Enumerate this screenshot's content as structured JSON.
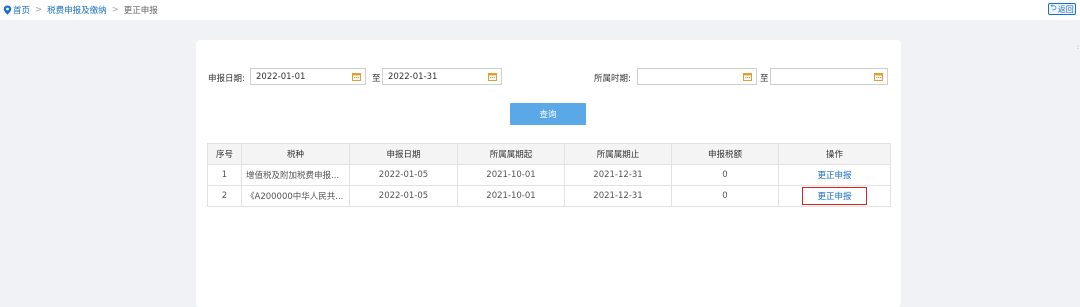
{
  "breadcrumb": {
    "home": "首页",
    "section": "税费申报及缴纳",
    "current": "更正申报"
  },
  "header": {
    "back_label": "返回"
  },
  "filters": {
    "declare_date_label": "申报日期:",
    "declare_start": "2022-01-01",
    "declare_to": "至",
    "declare_end": "2022-01-31",
    "period_label": "所属时期:",
    "period_start": "",
    "period_to": "至",
    "period_end": ""
  },
  "query_label": "查询",
  "table": {
    "columns": [
      "序号",
      "税种",
      "申报日期",
      "所属属期起",
      "所属属期止",
      "申报税额",
      "操作"
    ],
    "rows": [
      {
        "no": "1",
        "tax": "增值税及附加税费申报...",
        "date": "2022-01-05",
        "from": "2021-10-01",
        "to": "2021-12-31",
        "amount": "0",
        "action": "更正申报"
      },
      {
        "no": "2",
        "tax": "《A200000中华人民共...",
        "date": "2022-01-05",
        "from": "2021-10-01",
        "to": "2021-12-31",
        "amount": "0",
        "action": "更正申报"
      }
    ]
  },
  "colors": {
    "link": "#1a6fc4",
    "button": "#5aa9e6",
    "highlight": "#e02020",
    "calendar_icon": "#e0a030"
  },
  "icons": {
    "location": "location-pin-icon",
    "back": "return-arrow-icon",
    "calendar": "calendar-icon"
  }
}
